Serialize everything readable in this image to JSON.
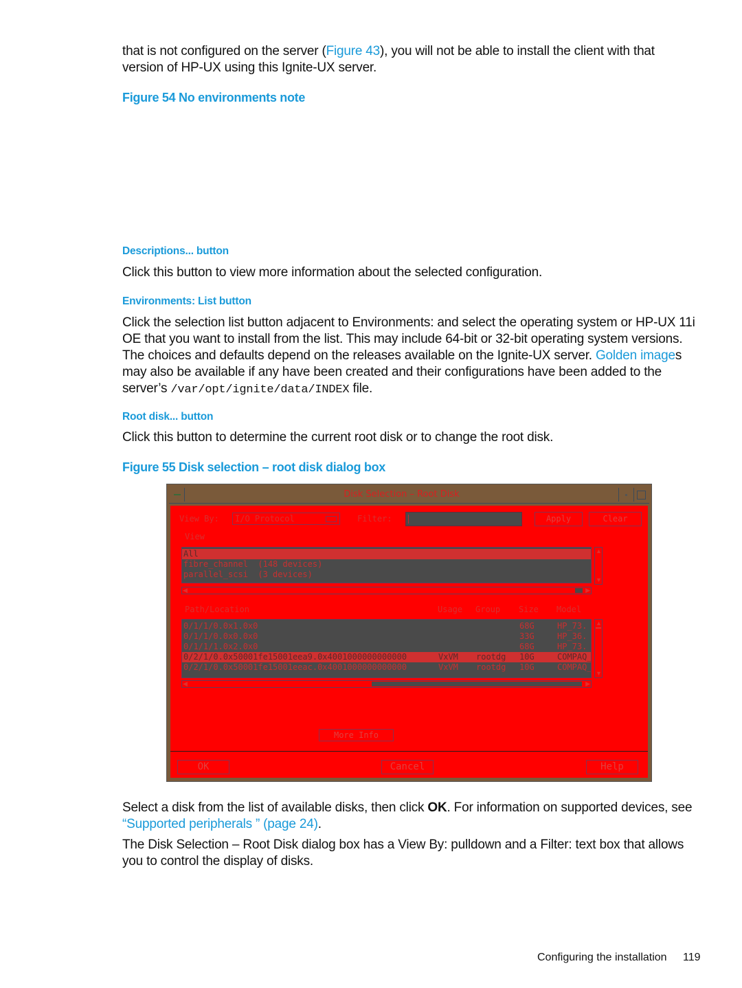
{
  "intro": {
    "line1_a": "that is not configured on the server (",
    "line1_link": "Figure 43",
    "line1_b": "), you will not be able to install the client with that",
    "line2": "version of HP-UX using this Ignite-UX server."
  },
  "figure54": {
    "caption": "Figure 54 No environments note"
  },
  "descriptions": {
    "heading": "Descriptions... button",
    "text": "Click this button to view more information about the selected configuration."
  },
  "environments": {
    "heading": "Environments: List button",
    "text_a": "Click the selection list button adjacent to Environments: and select the operating system or HP-UX 11i OE that you want to install from the list. This may include 64-bit or 32-bit operating system versions. The choices and defaults depend on the releases available on the Ignite-UX server. ",
    "link": "Golden image",
    "text_b": "s may also be available if any have been created and their configurations have been added to the server’s ",
    "path": "/var/opt/ignite/data/INDEX",
    "text_c": " file."
  },
  "rootdisk": {
    "heading": "Root disk... button",
    "text": "Click this button to determine the current root disk or to change the root disk."
  },
  "figure55": {
    "caption": "Figure 55 Disk selection – root disk dialog box"
  },
  "dialog": {
    "title": "Disk Selection – Root Disk",
    "view_by_label": "View By:",
    "view_by_value": "I/O Protocol",
    "filter_label": "Filter:",
    "filter_value": "",
    "apply": "Apply",
    "clear": "Clear",
    "view_label": "View",
    "view_items": [
      {
        "text": "All",
        "selected": true
      },
      {
        "text": "fibre_channel  (148 devices)",
        "selected": false
      },
      {
        "text": "parallel_scsi  (3 devices)",
        "selected": false
      }
    ],
    "disk_headers": {
      "path": "Path/Location",
      "usage": "Usage",
      "group": "Group",
      "size": "Size",
      "model": "Model"
    },
    "disks": [
      {
        "path": "0/1/1/0.0x1.0x0",
        "usage": "",
        "group": "",
        "size": "68G",
        "model": "HP_73.",
        "selected": false
      },
      {
        "path": "0/1/1/0.0x0.0x0",
        "usage": "",
        "group": "",
        "size": "33G",
        "model": "HP_36.",
        "selected": false
      },
      {
        "path": "0/1/1/1.0x2.0x0",
        "usage": "",
        "group": "",
        "size": "68G",
        "model": "HP_73.",
        "selected": false
      },
      {
        "path": "0/2/1/0.0x50001fe15001eea9.0x4001000000000000",
        "usage": "VxVM",
        "group": "rootdg",
        "size": "10G",
        "model": "COMPAQ_",
        "selected": true
      },
      {
        "path": "0/2/1/0.0x50001fe15001eeac.0x4001000000000000",
        "usage": "VxVM",
        "group": "rootdg",
        "size": "10G",
        "model": "COMPAQ_",
        "selected": false
      }
    ],
    "more_info": "More Info",
    "ok": "OK",
    "cancel": "Cancel",
    "help": "Help"
  },
  "after": {
    "p1_a": "Select a disk from the list of available disks, then click ",
    "p1_bold": "OK",
    "p1_b": ". For information on supported devices, see ",
    "p1_link": "“Supported peripherals ” (page 24)",
    "p1_c": ".",
    "p2": "The Disk Selection – Root Disk dialog box has a View By: pulldown and a Filter: text box that allows you to control the display of disks."
  },
  "footer": {
    "section": "Configuring the installation",
    "page": "119"
  },
  "colors": {
    "accent": "#1a9ad9",
    "dialog_bg": "#ff0000",
    "titlebar": "#7a5a3a",
    "list_bg": "#4a4a4a"
  }
}
